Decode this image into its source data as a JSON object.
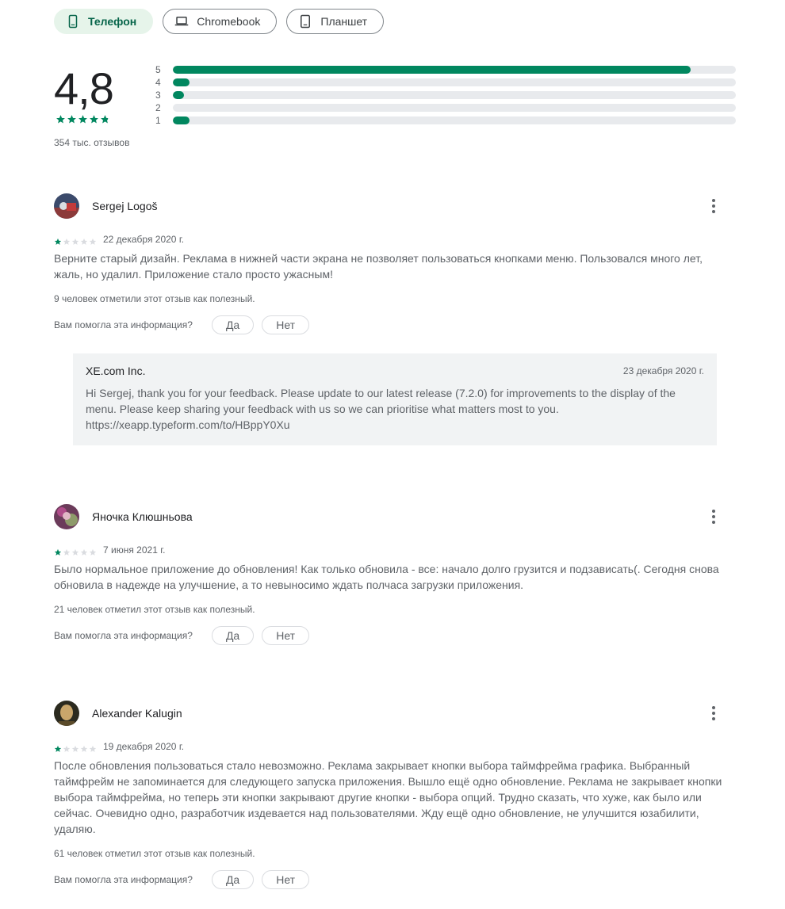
{
  "device_tabs": [
    {
      "label": "Телефон",
      "icon": "phone-icon",
      "active": true
    },
    {
      "label": "Chromebook",
      "icon": "laptop-icon",
      "active": false
    },
    {
      "label": "Планшет",
      "icon": "tablet-icon",
      "active": false
    }
  ],
  "summary": {
    "rating": "4,8",
    "stars": 4.8,
    "review_count": "354 тыс. отзывов",
    "histogram": [
      {
        "label": "5",
        "fraction": 0.92
      },
      {
        "label": "4",
        "fraction": 0.03
      },
      {
        "label": "3",
        "fraction": 0.02
      },
      {
        "label": "2",
        "fraction": 0.0
      },
      {
        "label": "1",
        "fraction": 0.03
      }
    ]
  },
  "colors": {
    "accent": "#01875f",
    "active_chip_bg": "#e6f4ea",
    "active_chip_text": "#056449",
    "track": "#e8eaed",
    "reply_bg": "#f1f3f4"
  },
  "reviews": [
    {
      "author": "Sergej Logoš",
      "stars": 1,
      "date": "22 декабря 2020 г.",
      "text": "Верните старый дизайн. Реклама в нижней части экрана не позволяет пользоваться кнопками меню. Пользовался много лет, жаль, но удалил. Приложение стало просто ужасным!",
      "helpful": "9 человек отметили этот отзыв как полезный.",
      "question": "Вам помогла эта информация?",
      "yes": "Да",
      "no": "Нет",
      "reply": {
        "developer": "XE.com Inc.",
        "date": "23 декабря 2020 г.",
        "text": "Hi Sergej, thank you for your feedback. Please update to our latest release (7.2.0) for improvements to the display of the menu. Please keep sharing your feedback with us so we can prioritise what matters most to you. https://xeapp.typeform.com/to/HBppY0Xu"
      }
    },
    {
      "author": "Яночка Клюшньова",
      "stars": 1,
      "date": "7 июня 2021 г.",
      "text": "Было нормальное приложение до обновления! Как только обновила - все: начало долго грузится и подзависать(. Сегодня снова обновила в надежде на улучшение, а то невыносимо ждать полчаса загрузки приложения.",
      "helpful": "21 человек отметил этот отзыв как полезный.",
      "question": "Вам помогла эта информация?",
      "yes": "Да",
      "no": "Нет"
    },
    {
      "author": "Alexander Kalugin",
      "stars": 1,
      "date": "19 декабря 2020 г.",
      "text": "После обновления пользоваться стало невозможно. Реклама закрывает кнопки выбора таймфрейма графика. Выбранный таймфрейм не запоминается для следующего запуска приложения. Вышло ещё одно обновление. Реклама не закрывает кнопки выбора таймфрейма, но теперь эти кнопки закрывают другие кнопки - выбора опций. Трудно сказать, что хуже, как было или сейчас. Очевидно одно, разработчик издевается над пользователями. Жду ещё одно обновление, не улучшится юзабилити, удаляю.",
      "helpful": "61 человек отметил этот отзыв как полезный.",
      "question": "Вам помогла эта информация?",
      "yes": "Да",
      "no": "Нет"
    }
  ]
}
